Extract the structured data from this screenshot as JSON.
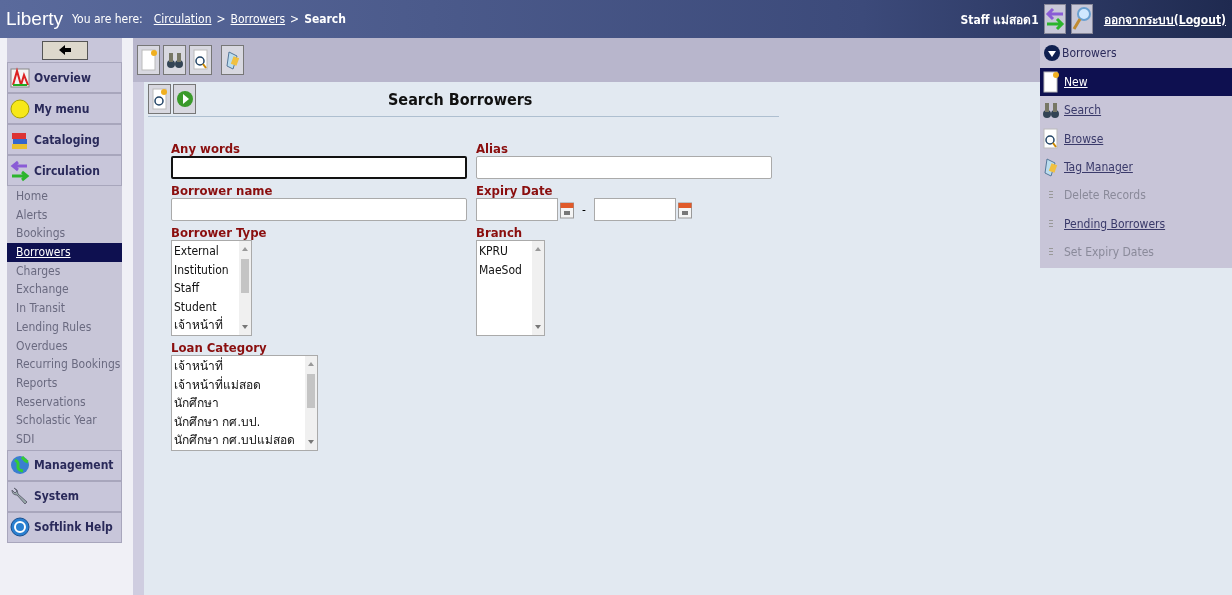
{
  "header": {
    "logo": "Liberty",
    "breadcrumb_label": "You are here:",
    "breadcrumb": [
      {
        "text": "Circulation",
        "kind": "link"
      },
      {
        "text": ">",
        "kind": "sep"
      },
      {
        "text": "Borrowers",
        "kind": "link"
      },
      {
        "text": ">",
        "kind": "sep"
      },
      {
        "text": "Search",
        "kind": "current"
      }
    ],
    "user": "Staff แม่สอด1",
    "logout": "ออกจากระบบ(Logout)"
  },
  "sidebar": {
    "sections": [
      {
        "label": "Overview"
      },
      {
        "label": "My menu"
      },
      {
        "label": "Cataloging"
      },
      {
        "label": "Circulation",
        "children": [
          {
            "label": "Home",
            "selected": false
          },
          {
            "label": "Alerts",
            "selected": false
          },
          {
            "label": "Bookings",
            "selected": false
          },
          {
            "label": "Borrowers",
            "selected": true
          },
          {
            "label": "Charges",
            "selected": false
          },
          {
            "label": "Exchange",
            "selected": false
          },
          {
            "label": "In Transit",
            "selected": false
          },
          {
            "label": "Lending Rules",
            "selected": false
          },
          {
            "label": "Overdues",
            "selected": false
          },
          {
            "label": "Recurring Bookings",
            "selected": false
          },
          {
            "label": "Reports",
            "selected": false
          },
          {
            "label": "Reservations",
            "selected": false
          },
          {
            "label": "Scholastic Year",
            "selected": false
          },
          {
            "label": "SDI",
            "selected": false
          }
        ]
      },
      {
        "label": "Management"
      },
      {
        "label": "System"
      },
      {
        "label": "Softlink Help"
      }
    ]
  },
  "form": {
    "title": "Search Borrowers",
    "fields": [
      {
        "label": "Any words",
        "kind": "text",
        "focused": true
      },
      {
        "label": "Alias",
        "kind": "text",
        "focused": false
      },
      {
        "label": "Borrower name",
        "kind": "text",
        "focused": false
      },
      {
        "label": "Expiry Date",
        "kind": "date_range",
        "separator": "-"
      },
      {
        "label": "Borrower Type",
        "kind": "listbox",
        "options": [
          "External",
          "Institution",
          "Staff",
          "Student",
          "เจ้าหน้าที่"
        ]
      },
      {
        "label": "Branch",
        "kind": "listbox",
        "options": [
          "KPRU",
          "MaeSod"
        ]
      },
      {
        "label": "Loan Category",
        "kind": "listbox",
        "options": [
          "เจ้าหน้าที่",
          "เจ้าหน้าที่แม่สอด",
          "นักศึกษา",
          "นักศึกษา กศ.บป.",
          "นักศึกษา กศ.บปแม่สอด"
        ]
      }
    ]
  },
  "panel": {
    "title": "Borrowers",
    "items": [
      {
        "label": "New",
        "selected": true,
        "disabled": false
      },
      {
        "label": "Search",
        "selected": false,
        "disabled": false
      },
      {
        "label": "Browse",
        "selected": false,
        "disabled": false
      },
      {
        "label": "Tag Manager",
        "selected": false,
        "disabled": false
      },
      {
        "label": "Delete Records",
        "selected": false,
        "disabled": true
      },
      {
        "label": "Pending Borrowers",
        "selected": false,
        "disabled": false
      },
      {
        "label": "Set Expiry Dates",
        "selected": false,
        "disabled": true
      }
    ]
  }
}
